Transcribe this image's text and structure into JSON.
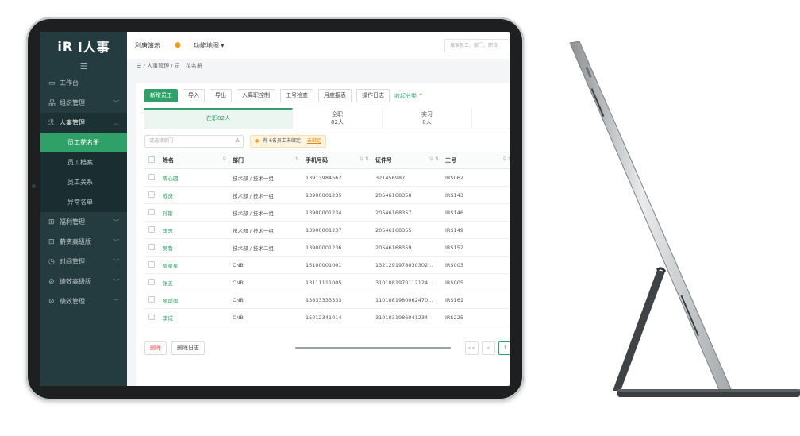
{
  "app": {
    "logo": "i人事",
    "logo_mark": "iR"
  },
  "sidebar": {
    "items": [
      {
        "label": "工作台",
        "icon": "monitor-icon",
        "glyph": "▭"
      },
      {
        "label": "组织管理",
        "icon": "org-chart-icon",
        "glyph": "品"
      },
      {
        "label": "人事管理",
        "icon": "person-icon",
        "glyph": "ℛ"
      },
      {
        "label": "员工花名册"
      },
      {
        "label": "员工档案"
      },
      {
        "label": "员工关系"
      },
      {
        "label": "异常名单"
      },
      {
        "label": "福利管理",
        "icon": "gift-icon",
        "glyph": "⊞"
      },
      {
        "label": "薪资高级版",
        "icon": "wallet-icon",
        "glyph": "⊡"
      },
      {
        "label": "时间管理",
        "icon": "clock-icon",
        "glyph": "◷"
      },
      {
        "label": "绩效高级版",
        "icon": "target-icon",
        "glyph": "⊘"
      },
      {
        "label": "绩效管理",
        "icon": "target-icon",
        "glyph": "⊘"
      }
    ]
  },
  "topbar": {
    "company": "利唐演示",
    "func_map": "功能地图 ▾",
    "search_placeholder": "搜索员工、部门、职位"
  },
  "breadcrumb": {
    "text": "☰ / 人事管理 / 员工花名册"
  },
  "toolbar": {
    "buttons": [
      "新增员工",
      "导入",
      "导出",
      "入离职控制",
      "工号检查",
      "月度报表",
      "操作日志"
    ],
    "collapse": "收起分类 ^"
  },
  "tabs": [
    {
      "label": "在职82人"
    },
    {
      "label": "全职",
      "count": "82人"
    },
    {
      "label": "实习",
      "count": "0人"
    }
  ],
  "filters": {
    "dept_placeholder": "请选择部门",
    "notice_text": "有 6名员工未绑定，",
    "notice_link": "去绑定"
  },
  "table": {
    "headers": [
      "姓名",
      "部门",
      "手机号码",
      "证件号",
      "工号"
    ],
    "rows": [
      [
        "周心圆",
        "技术部 / 技术一组",
        "13913984562",
        "321456987",
        "IRS062"
      ],
      [
        "成员",
        "技术部 / 技术一组",
        "13900001235",
        "20546168358",
        "IRS143"
      ],
      [
        "孙斯",
        "技术部 / 技术一组",
        "13900001234",
        "20546168357",
        "IRS146"
      ],
      [
        "李思",
        "技术部 / 技术一组",
        "13900001237",
        "20546168355",
        "IRS149"
      ],
      [
        "吴鲁",
        "技术部 / 技术二组",
        "13900001236",
        "20546168359",
        "IRS152"
      ],
      [
        "周星星",
        "CNB",
        "15100001001",
        "1321291978030302...",
        "IRS003"
      ],
      [
        "张五",
        "CNB",
        "13111111005",
        "3101081970112124...",
        "IRS005"
      ],
      [
        "吴斯雨",
        "CNB",
        "13833333333",
        "1101081980062470...",
        "IRS161"
      ],
      [
        "李成",
        "CNB",
        "15012341014",
        "3101031986041234",
        "IRS225"
      ]
    ]
  },
  "footer": {
    "delete_label": "删除",
    "delete_log_label": "删除日志"
  },
  "pager": {
    "first": "<<",
    "prev": "<",
    "current": "1"
  },
  "colors": {
    "accent": "#2fa168",
    "sidebar": "#243b3f",
    "warning": "#f39c12"
  }
}
